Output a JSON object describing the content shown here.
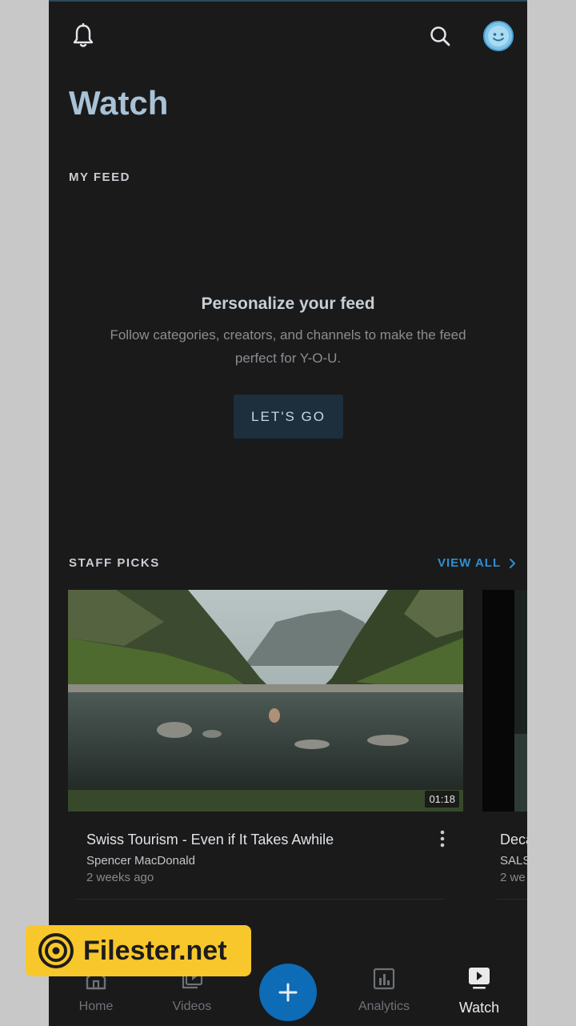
{
  "header": {
    "title": "Watch",
    "notifications_icon": "bell-icon",
    "search_icon": "search-icon",
    "avatar_icon": "smiley-avatar"
  },
  "my_feed": {
    "label": "MY FEED",
    "empty_title": "Personalize your feed",
    "empty_description": "Follow categories, creators, and channels to make the feed perfect for Y-O-U.",
    "cta_label": "LET'S GO"
  },
  "staff_picks": {
    "label": "STAFF PICKS",
    "view_all_label": "VIEW ALL",
    "videos": [
      {
        "title": "Swiss Tourism - Even if It Takes Awhile",
        "author": "Spencer MacDonald",
        "posted": "2 weeks ago",
        "duration": "01:18"
      },
      {
        "title": "Deca",
        "author": "SALS",
        "posted": "2 we"
      }
    ]
  },
  "bottom_nav": {
    "items": [
      {
        "label": "Home",
        "icon": "home-icon"
      },
      {
        "label": "Videos",
        "icon": "videos-icon"
      },
      {
        "label": "Analytics",
        "icon": "analytics-icon"
      },
      {
        "label": "Watch",
        "icon": "watch-icon",
        "active": true
      }
    ],
    "fab_icon": "plus-icon"
  },
  "watermark": {
    "text": "Filester.net"
  },
  "colors": {
    "background": "#1a1a1b",
    "accent": "#2f8fd0",
    "fab": "#0e6bb5",
    "title": "#a8c2d6",
    "badge": "#f8c72b"
  }
}
